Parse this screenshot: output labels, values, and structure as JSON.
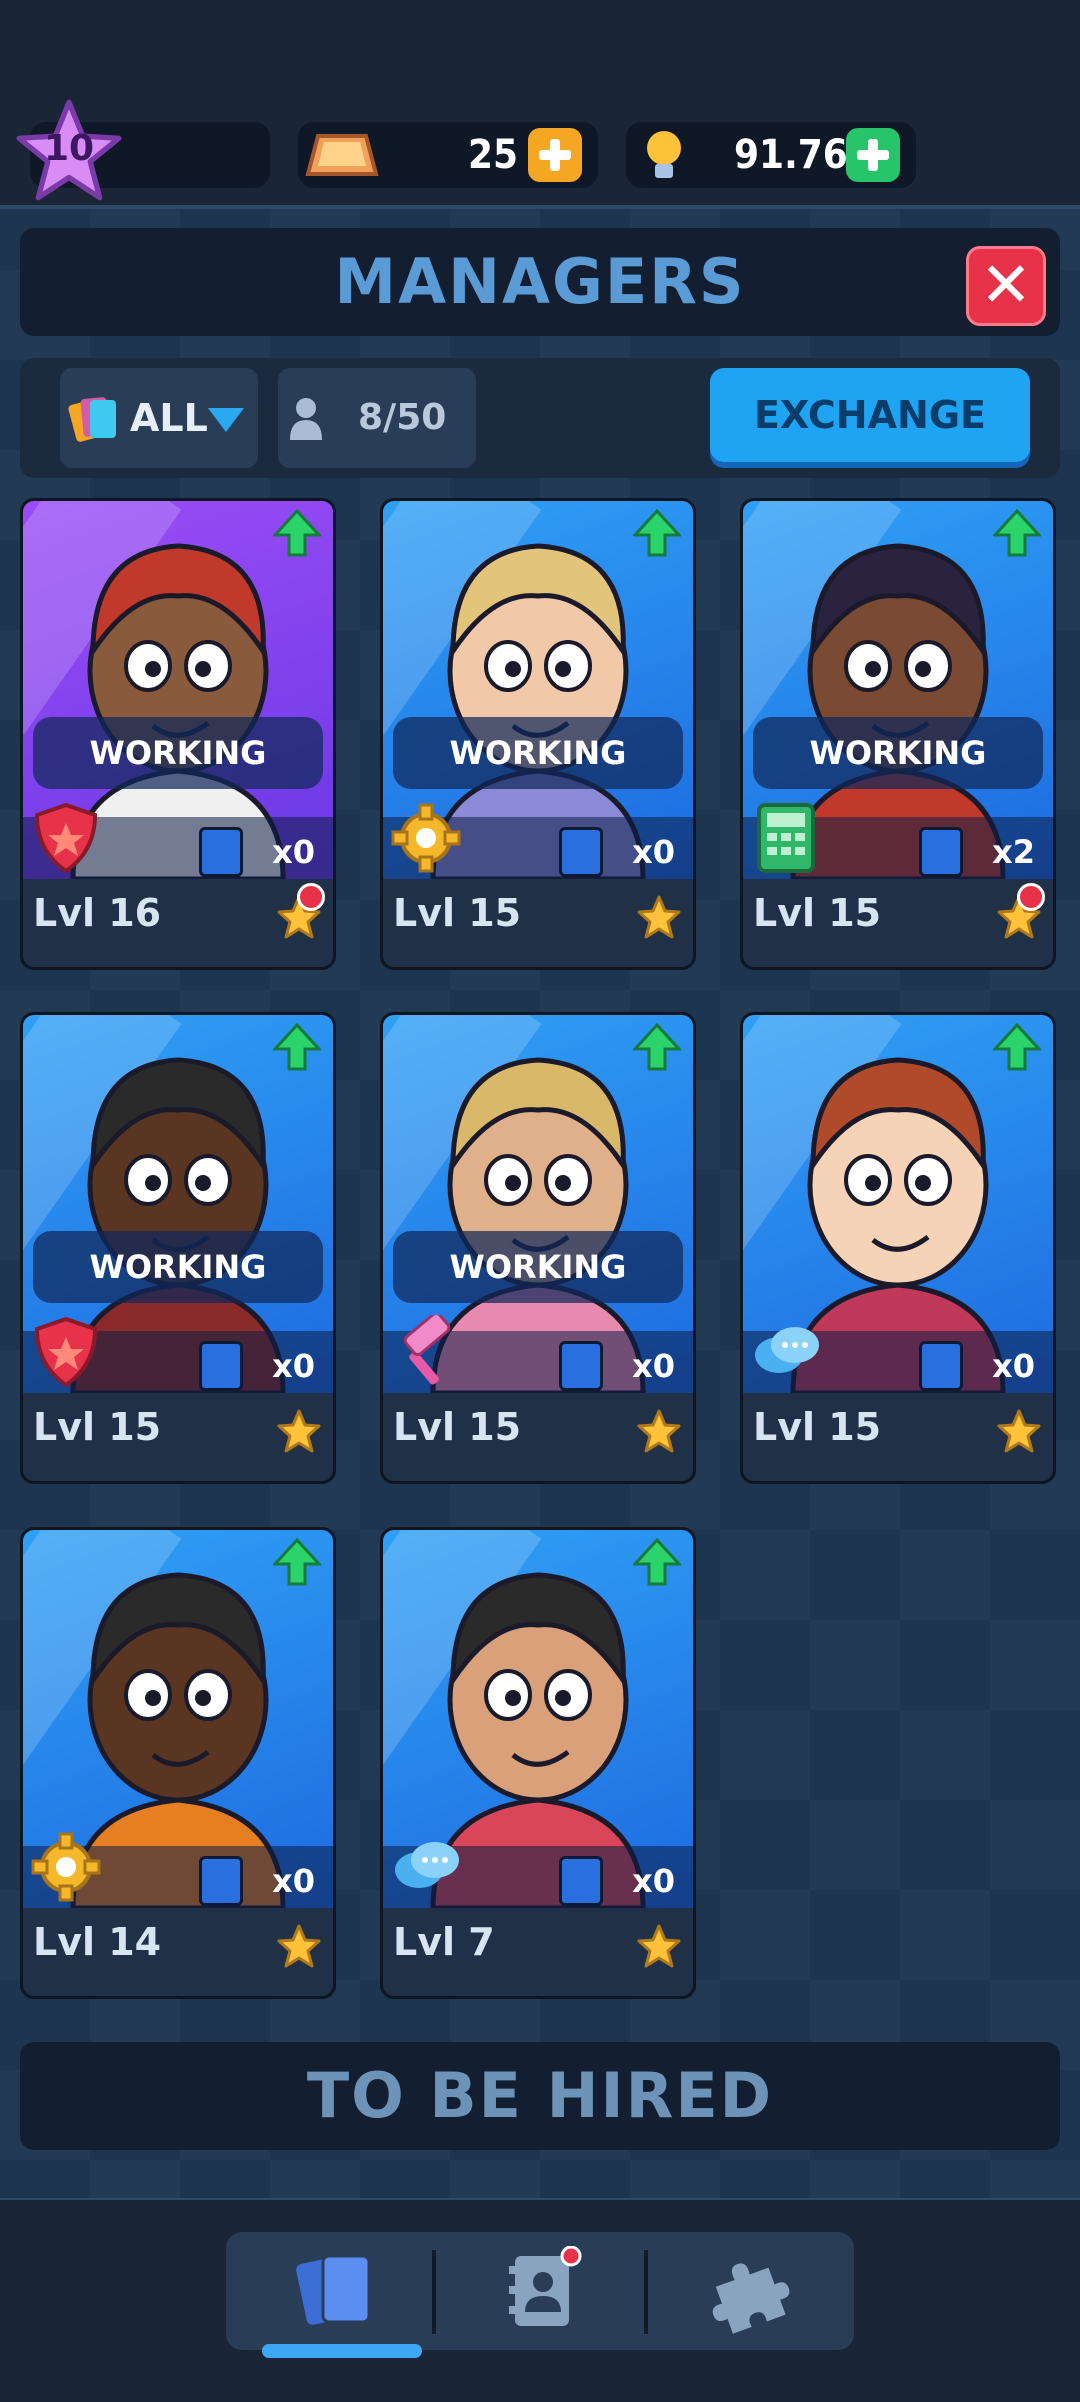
{
  "currency": {
    "level": "10",
    "gold": "25",
    "ideas": "91.768"
  },
  "header": {
    "title": "MANAGERS"
  },
  "filter": {
    "label": "ALL",
    "count": "8/50",
    "exchange_label": "EXCHANGE"
  },
  "cards": [
    {
      "level": "Lvl 16",
      "status": "WORKING",
      "count": "x0",
      "role_icon": "shield-icon",
      "notification": true
    },
    {
      "level": "Lvl 15",
      "status": "WORKING",
      "count": "x0",
      "role_icon": "gear-icon",
      "notification": false
    },
    {
      "level": "Lvl 15",
      "status": "WORKING",
      "count": "x2",
      "role_icon": "calculator-icon",
      "notification": true
    },
    {
      "level": "Lvl 15",
      "status": "WORKING",
      "count": "x0",
      "role_icon": "shield-icon",
      "notification": false
    },
    {
      "level": "Lvl 15",
      "status": "WORKING",
      "count": "x0",
      "role_icon": "hammer-icon",
      "notification": false
    },
    {
      "level": "Lvl 15",
      "status": "",
      "count": "x0",
      "role_icon": "chat-icon",
      "notification": false
    },
    {
      "level": "Lvl 14",
      "status": "",
      "count": "x0",
      "role_icon": "gear-icon",
      "notification": false
    },
    {
      "level": "Lvl 7",
      "status": "",
      "count": "x0",
      "role_icon": "chat-icon",
      "notification": false
    }
  ],
  "hire_section": {
    "title": "TO BE HIRED"
  },
  "bottom_nav": {
    "tabs": [
      "cards-tab-icon",
      "contacts-tab-icon",
      "puzzle-tab-icon"
    ],
    "active_tab": 0
  },
  "colors": {
    "accent_blue": "#1ea4f2",
    "close_red": "#e8324a",
    "plus_orange": "#f5a623",
    "plus_green": "#27c46a",
    "card_purple": "#8a4bf0",
    "card_blue": "#1e8cf0"
  }
}
